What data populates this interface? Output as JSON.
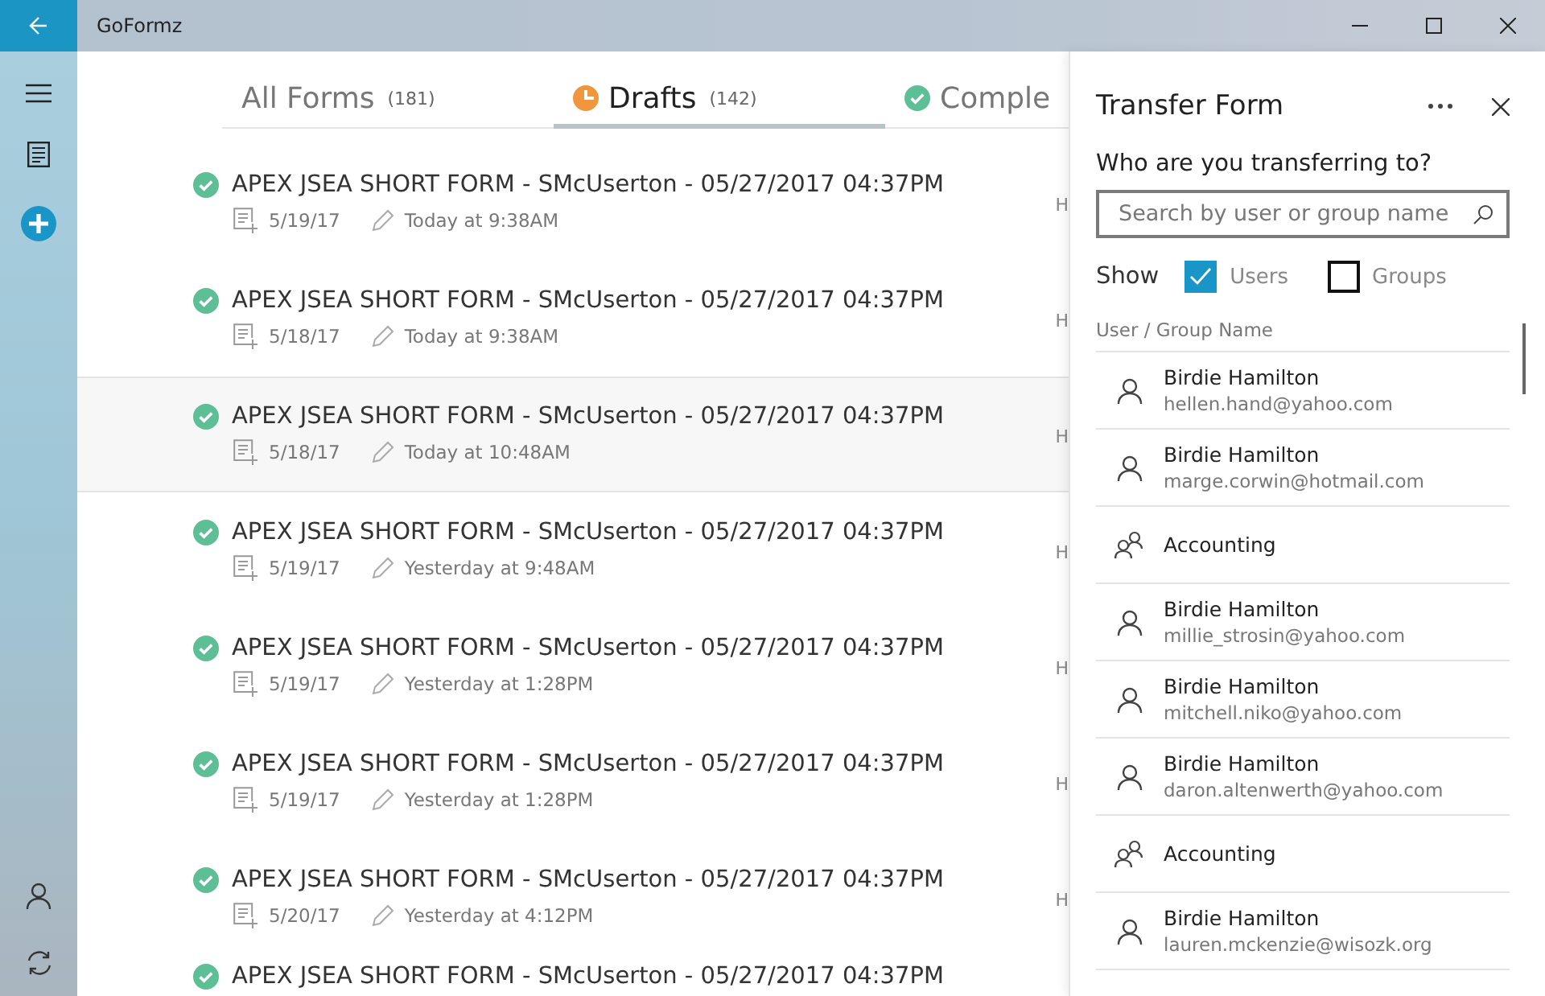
{
  "window": {
    "title": "GoFormz"
  },
  "tabs": [
    {
      "label": "All Forms",
      "count": "(181)",
      "selected": false,
      "kind": "plain"
    },
    {
      "label": "Drafts",
      "count": "(142)",
      "selected": true,
      "kind": "draft"
    },
    {
      "label": "Comple",
      "selected": false,
      "kind": "complete"
    }
  ],
  "forms": [
    {
      "title": "APEX JSEA SHORT FORM - SMcUserton - 05/27/2017 04:37PM",
      "created": "5/19/17",
      "edited": "Today at 9:38AM",
      "column_3": "H",
      "selected": false
    },
    {
      "title": "APEX JSEA SHORT FORM - SMcUserton - 05/27/2017 04:37PM",
      "created": "5/18/17",
      "edited": "Today at 9:38AM",
      "column_3": "H",
      "selected": false
    },
    {
      "title": "APEX JSEA SHORT FORM - SMcUserton - 05/27/2017 04:37PM",
      "created": "5/18/17",
      "edited": "Today at 10:48AM",
      "column_3": "H",
      "selected": true
    },
    {
      "title": "APEX JSEA SHORT FORM - SMcUserton - 05/27/2017 04:37PM",
      "created": "5/19/17",
      "edited": "Yesterday at 9:48AM",
      "column_3": "H",
      "selected": false
    },
    {
      "title": "APEX JSEA SHORT FORM - SMcUserton - 05/27/2017 04:37PM",
      "created": "5/19/17",
      "edited": "Yesterday at 1:28PM",
      "column_3": "H",
      "selected": false
    },
    {
      "title": "APEX JSEA SHORT FORM - SMcUserton - 05/27/2017 04:37PM",
      "created": "5/19/17",
      "edited": "Yesterday at 1:28PM",
      "column_3": "H",
      "selected": false
    },
    {
      "title": "APEX JSEA SHORT FORM - SMcUserton - 05/27/2017 04:37PM",
      "created": "5/20/17",
      "edited": "Yesterday at 4:12PM",
      "column_3": "H",
      "selected": false
    }
  ],
  "partial_row": {
    "title": "APEX JSEA SHORT FORM - SMcUserton - 05/27/2017 04:37PM"
  },
  "panel": {
    "title": "Transfer Form",
    "question": "Who are you transferring to?",
    "search": {
      "placeholder": "Search by user or group name"
    },
    "show_label": "Show",
    "filters": [
      {
        "label": "Users",
        "checked": true
      },
      {
        "label": "Groups",
        "checked": false
      }
    ],
    "list_header": "User / Group Name",
    "items": [
      {
        "kind": "user",
        "name": "Birdie Hamilton",
        "email": "hellen.hand@yahoo.com"
      },
      {
        "kind": "user",
        "name": "Birdie Hamilton",
        "email": "marge.corwin@hotmail.com"
      },
      {
        "kind": "group",
        "name": "Accounting"
      },
      {
        "kind": "user",
        "name": "Birdie Hamilton",
        "email": "millie_strosin@yahoo.com"
      },
      {
        "kind": "user",
        "name": "Birdie Hamilton",
        "email": "mitchell.niko@yahoo.com"
      },
      {
        "kind": "user",
        "name": "Birdie Hamilton",
        "email": "daron.altenwerth@yahoo.com"
      },
      {
        "kind": "group",
        "name": "Accounting"
      },
      {
        "kind": "user",
        "name": "Birdie Hamilton",
        "email": "lauren.mckenzie@wisozk.org"
      }
    ]
  }
}
